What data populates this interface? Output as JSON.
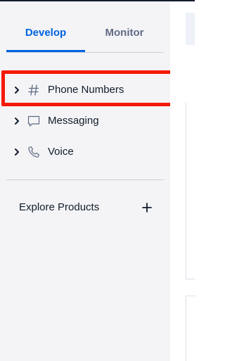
{
  "tabs": [
    {
      "label": "Develop",
      "active": true
    },
    {
      "label": "Monitor",
      "active": false
    }
  ],
  "nav": {
    "items": [
      {
        "label": "Phone Numbers",
        "icon": "hash-icon",
        "expanded": false
      },
      {
        "label": "Messaging",
        "icon": "chat-bubble-icon",
        "expanded": false
      },
      {
        "label": "Voice",
        "icon": "phone-icon",
        "expanded": false
      }
    ]
  },
  "explore": {
    "label": "Explore Products",
    "icon": "plus-icon"
  },
  "colors": {
    "accent": "#0263e0",
    "highlight": "#f51a06",
    "sidebar_bg": "#f4f4f6",
    "text": "#121c2d",
    "muted": "#606b85"
  }
}
